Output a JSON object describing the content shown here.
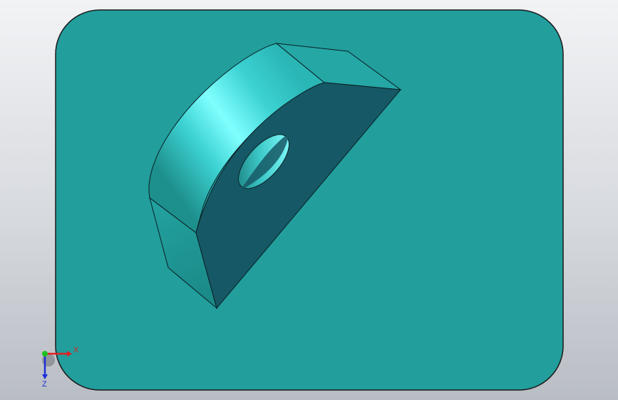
{
  "viewport": {
    "background_gradient": [
      "#f2f3f5",
      "#d6d9de",
      "#b9bdc4"
    ]
  },
  "sheet": {
    "color": "#229e9c",
    "border_color": "#1a1a1a"
  },
  "model": {
    "name": "half-disc-part-with-hole",
    "colors": {
      "front_face": "#165865",
      "top_face": "#25a7a6",
      "lower_left_face": "#1c8b89",
      "curved_highlight": "#80ffff",
      "curved_mid": "#3cd2d2",
      "curved_shadow": "#1d8f8c",
      "hole_light": "#87ffff",
      "hole_dark": "#1b807f",
      "edge": "#0a1f25"
    }
  },
  "triad": {
    "x_label": "X",
    "z_label": "Z",
    "x_color": "#e02020",
    "y_color": "#20c020",
    "z_color": "#1d2fd8"
  }
}
